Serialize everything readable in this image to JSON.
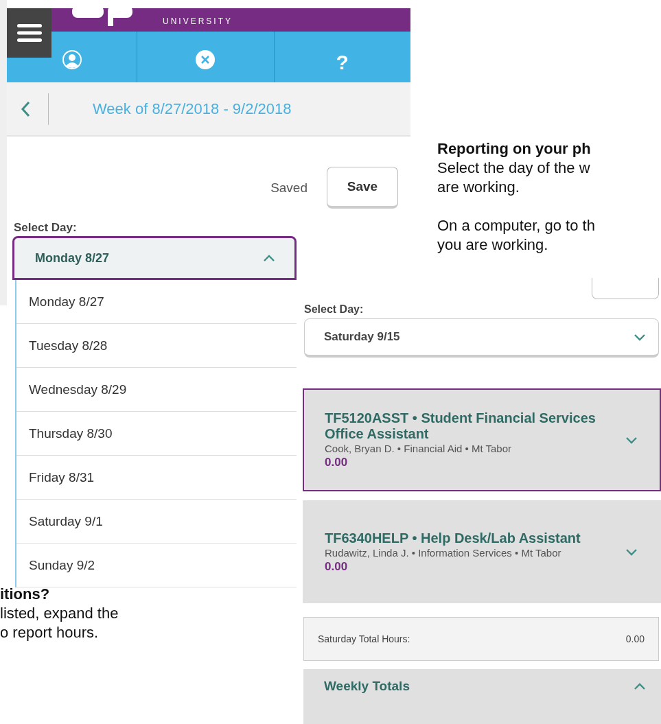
{
  "phone_screen": {
    "brand": "UNIVERSITY",
    "help_label": "?",
    "week_title": "Week of 8/27/2018 - 9/2/2018",
    "status": "Saved",
    "save_button": "Save",
    "select_label": "Select Day:",
    "dropdown": {
      "value": "Monday 8/27",
      "expanded": true
    },
    "day_options": [
      {
        "label": "Monday 8/27"
      },
      {
        "label": "Tuesday 8/28"
      },
      {
        "label": "Wednesday 8/29"
      },
      {
        "label": "Thursday 8/30"
      },
      {
        "label": "Friday 8/31"
      },
      {
        "label": "Saturday 9/1"
      },
      {
        "label": "Sunday 9/2"
      }
    ]
  },
  "instructions": {
    "heading": "Reporting on your ph",
    "paragraphs": [
      [
        "Select the day of the w",
        "are working."
      ],
      [
        "On a computer, go to th",
        "you are working."
      ]
    ]
  },
  "computer_screen": {
    "select_label": "Select Day:",
    "dropdown": {
      "value": "Saturday 9/15",
      "expanded": false
    },
    "positions": [
      {
        "title": "TF5120ASST • Student Financial Services Office Assistant",
        "details": "Cook, Bryan D. • Financial Aid • Mt Tabor",
        "hours": "0.00",
        "selected": true,
        "expanded": false
      },
      {
        "title": "TF6340HELP • Help Desk/Lab Assistant",
        "details": "Rudawitz, Linda J. • Information Services • Mt Tabor",
        "hours": "0.00",
        "selected": false,
        "expanded": false
      }
    ],
    "day_total": {
      "label": "Saturday Total Hours:",
      "value": "0.00"
    },
    "weekly_totals": {
      "label": "Weekly Totals",
      "expanded": true
    }
  },
  "note": {
    "heading": "itions?",
    "lines": [
      "listed, expand the",
      "o report hours."
    ]
  }
}
